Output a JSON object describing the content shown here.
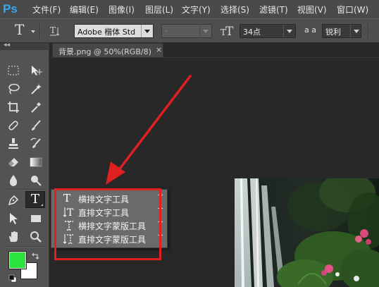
{
  "app": {
    "logo_text": "Ps"
  },
  "menu": [
    "文件(F)",
    "编辑(E)",
    "图像(I)",
    "图层(L)",
    "文字(Y)",
    "选择(S)",
    "滤镜(T)",
    "视图(V)",
    "窗口(W)"
  ],
  "options_bar": {
    "font_family": "Adobe 楷体 Std",
    "font_style": "-",
    "font_size": "34点",
    "aa_label": "a a",
    "antialias": "锐利"
  },
  "document": {
    "tab_title": "背景.png @ 50%(RGB/8)",
    "close_symbol": "×"
  },
  "flyout": {
    "items": [
      {
        "label": "横排文字工具",
        "icon": "horizontal-type-icon",
        "key": "T"
      },
      {
        "label": "直排文字工具",
        "icon": "vertical-type-icon",
        "key": "T"
      },
      {
        "label": "横排文字蒙版工具",
        "icon": "horizontal-type-mask-icon",
        "key": "T"
      },
      {
        "label": "直排文字蒙版工具",
        "icon": "vertical-type-mask-icon",
        "key": "T"
      }
    ]
  },
  "colors": {
    "foreground": "#2be33a",
    "background": "#ffffff",
    "annotation": "#e02020"
  }
}
